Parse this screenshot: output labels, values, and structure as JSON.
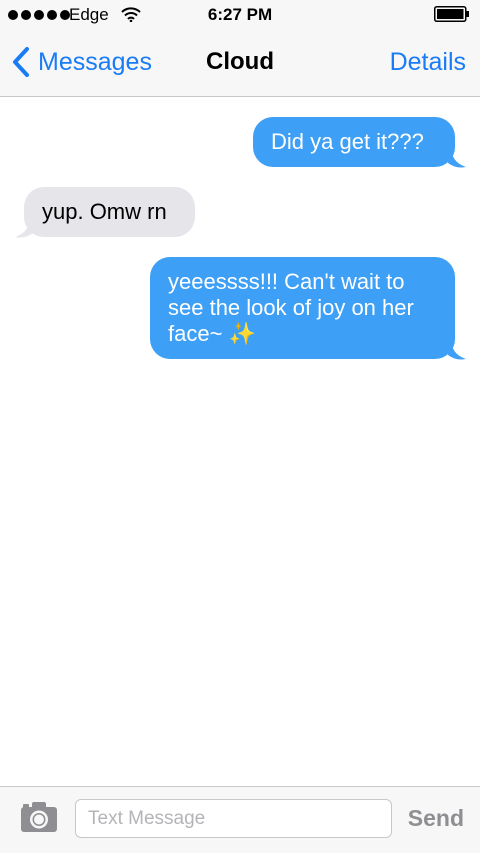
{
  "status_bar": {
    "carrier": "Edge",
    "time": "6:27 PM",
    "icons": [
      "signal-dots",
      "wifi-icon",
      "battery-icon"
    ]
  },
  "nav": {
    "back_label": "Messages",
    "title": "Cloud",
    "details_label": "Details"
  },
  "messages": [
    {
      "direction": "outgoing",
      "lines": [
        "Did ya get it???"
      ]
    },
    {
      "direction": "incoming",
      "lines": [
        "yup. Omw rn"
      ]
    },
    {
      "direction": "outgoing",
      "lines": [
        "yeeessss!!! Can't wait to",
        "see the look of joy on her",
        "face~ ✨"
      ]
    }
  ],
  "input": {
    "placeholder": "Text Message",
    "value": "",
    "send_label": "Send"
  },
  "colors": {
    "accent": "#1a7cf5",
    "outgoing_bubble": "#3d9ff5",
    "incoming_bubble": "#e5e5ea",
    "sparkle": "#f5c518"
  }
}
